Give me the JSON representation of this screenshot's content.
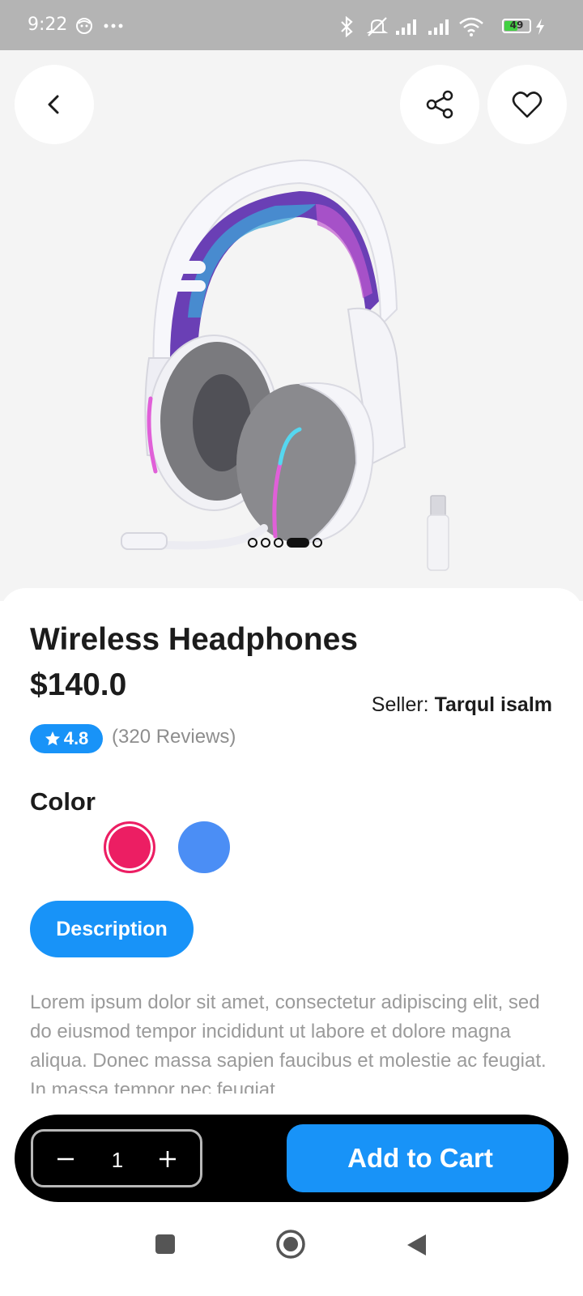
{
  "status_bar": {
    "time": "9:22",
    "battery_level": "49",
    "icons": [
      "face-icon",
      "more-dots-icon",
      "bluetooth-icon",
      "mute-icon",
      "signal-icon",
      "signal-icon",
      "wifi-icon",
      "battery-icon",
      "charging-icon"
    ]
  },
  "hero": {
    "back_icon": "chevron-left-icon",
    "share_icon": "share-icon",
    "favorite_icon": "heart-icon",
    "image_count": 5,
    "active_image_index": 3
  },
  "product": {
    "title": "Wireless Headphones",
    "price": "$140.0",
    "seller_label": "Seller: ",
    "seller_name": "Tarqul isalm",
    "rating": "4.8",
    "reviews": "(320 Reviews)"
  },
  "colors": {
    "label": "Color",
    "options": [
      {
        "name": "white",
        "hex": "#ffffff"
      },
      {
        "name": "pink",
        "hex": "#ec1e63",
        "selected": true
      },
      {
        "name": "blue",
        "hex": "#4b8ef5"
      }
    ]
  },
  "description": {
    "tab_label": "Description",
    "text": "Lorem ipsum dolor sit amet, consectetur adipiscing elit, sed do eiusmod tempor incididunt ut labore et dolore magna aliqua. Donec massa sapien faucibus et molestie ac feugiat. In massa tempor nec feugiat"
  },
  "cart": {
    "quantity": "1",
    "add_label": "Add to Cart"
  },
  "theme": {
    "accent": "#1893f8",
    "hero_background": "#f4f4f4",
    "text": "#1c1c1c",
    "muted": "#9a9a9a"
  }
}
